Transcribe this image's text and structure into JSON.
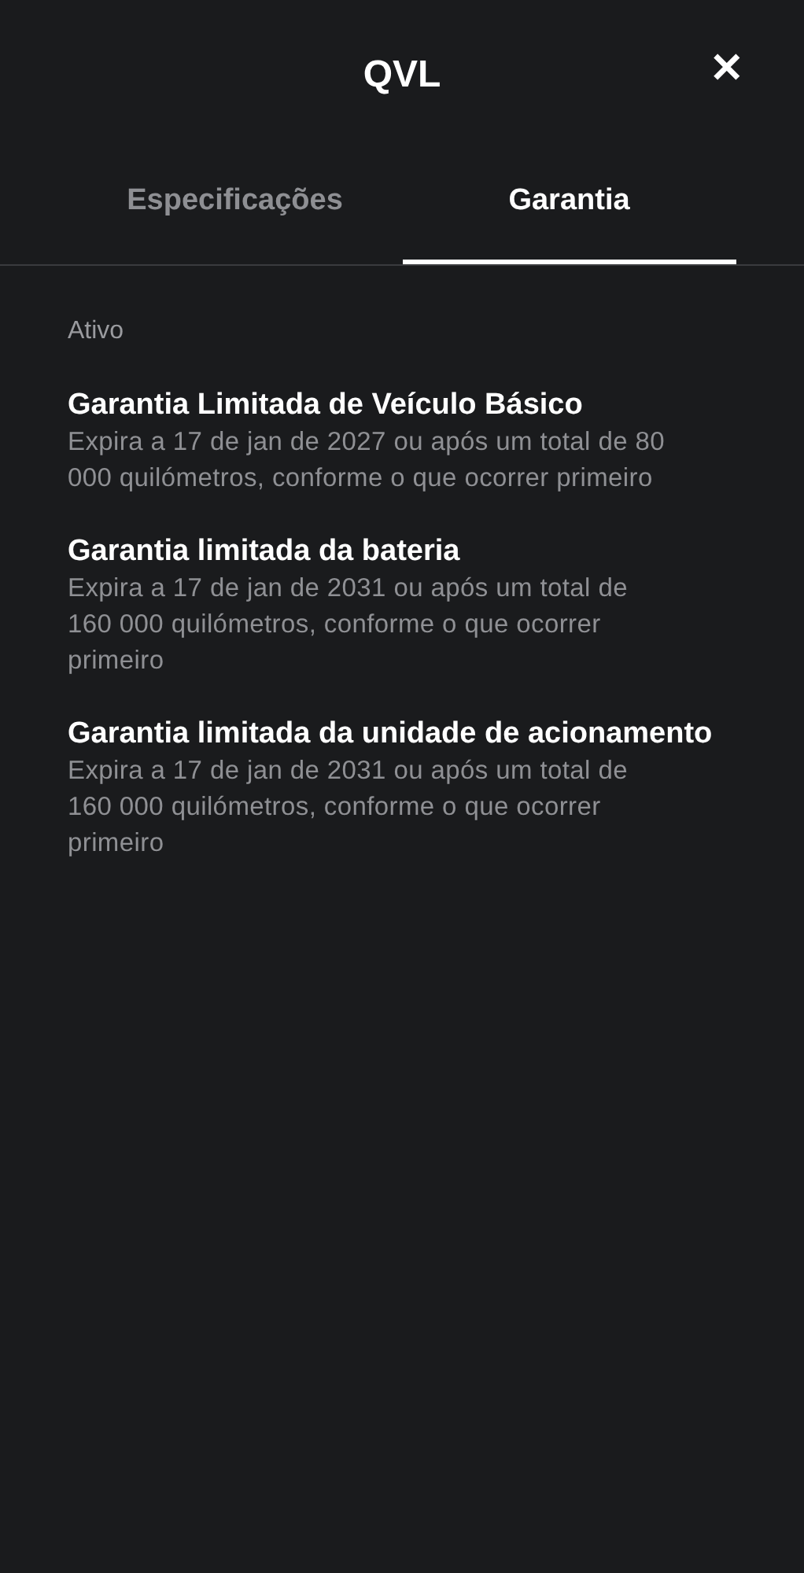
{
  "header": {
    "title": "QVL",
    "close": "✕"
  },
  "tabs": [
    {
      "label": "Especificações",
      "selected": false
    },
    {
      "label": "Garantia",
      "selected": true
    }
  ],
  "section": {
    "label": "Ativo"
  },
  "warranties": [
    {
      "title": "Garantia Limitada de Veículo Básico",
      "description": "Expira a 17 de jan de 2027 ou após um total de 80 000 quilómetros, conforme o que ocorrer primeiro"
    },
    {
      "title": "Garantia limitada da bateria",
      "description": "Expira a 17 de jan de 2031 ou após um total de 160 000 quilómetros, conforme o que ocorrer primeiro"
    },
    {
      "title": "Garantia limitada da unidade de acionamento",
      "description": "Expira a 17 de jan de 2031 ou após um total de 160 000 quilómetros, conforme o que ocorrer primeiro"
    }
  ]
}
